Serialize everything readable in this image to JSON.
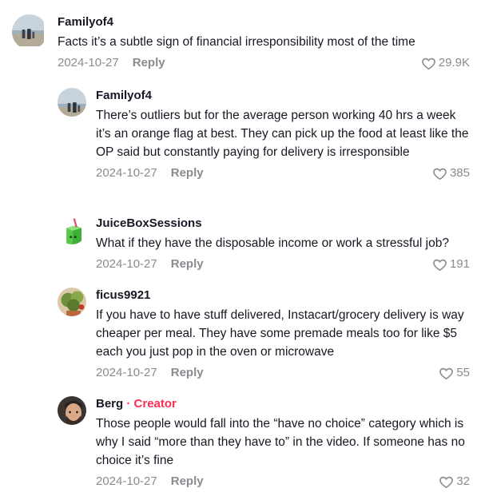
{
  "comments": [
    {
      "username": "Familyof4",
      "text": "Facts it’s a subtle sign of financial irresponsibility most of the time",
      "date": "2024-10-27",
      "reply_label": "Reply",
      "likes": "29.9K"
    },
    {
      "username": "Familyof4",
      "text": "There’s outliers but for the average person working 40 hrs a week it’s an orange flag at best. They can pick up the food at least like the OP said but constantly paying for delivery is irresponsible",
      "date": "2024-10-27",
      "reply_label": "Reply",
      "likes": "385"
    },
    {
      "username": "JuiceBoxSessions",
      "text": "What if they have the disposable income or work a stressful job?",
      "date": "2024-10-27",
      "reply_label": "Reply",
      "likes": "191"
    },
    {
      "username": "ficus9921",
      "text": "If you have to have stuff delivered, Instacart/grocery delivery is way cheaper per meal. They have some premade meals too for like $5 each you just pop in the oven or microwave",
      "date": "2024-10-27",
      "reply_label": "Reply",
      "likes": "55"
    },
    {
      "username": "Berg",
      "badge": " · Creator",
      "text": "Those people would fall into the “have no choice” category which is why I said “more than they have to” in the video. If someone has no choice it’s fine",
      "date": "2024-10-27",
      "reply_label": "Reply",
      "likes": "32"
    }
  ],
  "colors": {
    "creator": "#fe2c55",
    "muted": "#8a8b91",
    "text": "#161823"
  }
}
